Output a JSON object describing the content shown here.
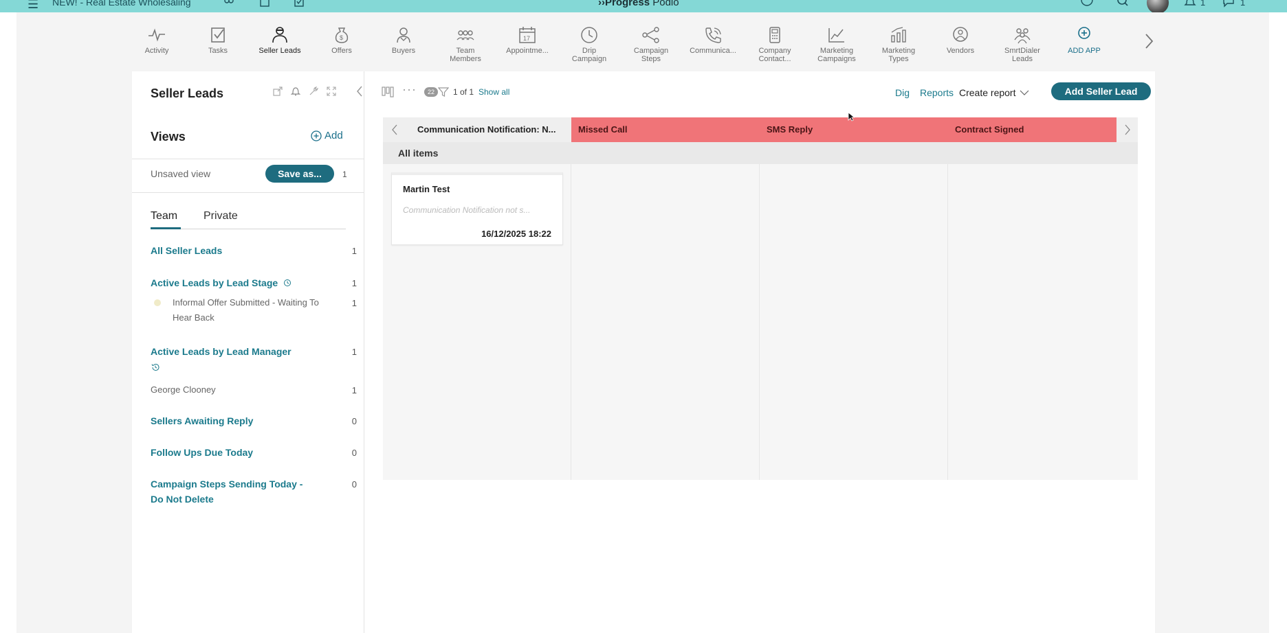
{
  "topbar": {
    "workspace_name": "NEW! - Real Estate Wholesaling",
    "logo_bold": "Progress",
    "logo_light": "Podio",
    "notifications_count": "1",
    "messages_count": "1"
  },
  "apps": [
    {
      "label": "Activity",
      "icon": "activity-icon"
    },
    {
      "label": "Tasks",
      "icon": "tasks-icon"
    },
    {
      "label": "Seller Leads",
      "icon": "seller-leads-icon",
      "active": true
    },
    {
      "label": "Offers",
      "icon": "offers-icon"
    },
    {
      "label": "Buyers",
      "icon": "buyers-icon"
    },
    {
      "label": "Team\nMembers",
      "icon": "team-members-icon"
    },
    {
      "label": "Appointme...",
      "icon": "calendar-icon"
    },
    {
      "label": "Drip\nCampaign",
      "icon": "clock-icon"
    },
    {
      "label": "Campaign\nSteps",
      "icon": "campaign-steps-icon"
    },
    {
      "label": "Communica...",
      "icon": "phone-icon"
    },
    {
      "label": "Company\nContact...",
      "icon": "company-contact-icon"
    },
    {
      "label": "Marketing\nCampaigns",
      "icon": "marketing-campaigns-icon"
    },
    {
      "label": "Marketing\nTypes",
      "icon": "marketing-types-icon"
    },
    {
      "label": "Vendors",
      "icon": "vendors-icon"
    },
    {
      "label": "SmrtDialer\nLeads",
      "icon": "smrtdialer-leads-icon"
    },
    {
      "label": "ADD APP",
      "icon": "add-app-icon"
    }
  ],
  "sidebar": {
    "title": "Seller Leads",
    "views_title": "Views",
    "add_label": "Add",
    "unsaved_label": "Unsaved view",
    "save_as_label": "Save as...",
    "unsaved_count": "1",
    "tabs": [
      "Team",
      "Private"
    ],
    "views": [
      {
        "label": "All Seller Leads",
        "count": "1"
      },
      {
        "label": "Active Leads by Lead Stage",
        "count": "1"
      },
      {
        "label": "Active Leads by Lead Manager",
        "count": "1"
      },
      {
        "label": "Sellers Awaiting Reply",
        "count": "0"
      },
      {
        "label": "Follow Ups Due Today",
        "count": "0"
      },
      {
        "label": "Campaign Steps Sending Today - Do Not Delete",
        "count": "0"
      }
    ],
    "stage_sub": {
      "label": "Informal Offer Submitted - Waiting To Hear Back",
      "count": "1"
    },
    "manager_sub": {
      "label": "George Clooney",
      "count": "1"
    }
  },
  "toolbar": {
    "filter_badge": "22",
    "pages": "1 of 1",
    "show_all": "Show all",
    "dig": "Dig",
    "reports": "Reports",
    "create_report": "Create report",
    "add_button": "Add Seller Lead"
  },
  "board": {
    "columns": [
      "Communication Notification: N...",
      "Missed Call",
      "SMS Reply",
      "Contract Signed"
    ],
    "group_label": "All items",
    "card": {
      "title": "Martin Test",
      "description": "Communication Notification not s...",
      "date": "16/12/2025 18:22"
    }
  },
  "colors": {
    "topbar": "#84d8d6",
    "accent": "#1e6c7f",
    "link": "#1b7a8c",
    "stage_header": "#f07478"
  }
}
